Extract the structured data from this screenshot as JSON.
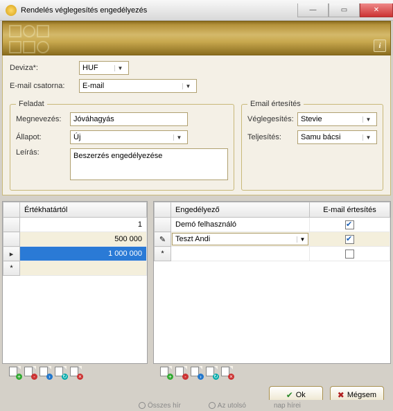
{
  "window": {
    "title": "Rendelés véglegesítés engedélyezés"
  },
  "form": {
    "currency_label": "Deviza*:",
    "currency_value": "HUF",
    "email_channel_label": "E-mail csatorna:",
    "email_channel_value": "E-mail"
  },
  "task_group": {
    "legend": "Feladat",
    "name_label": "Megnevezés:",
    "name_value": "Jóváhagyás",
    "status_label": "Állapot:",
    "status_value": "Új",
    "desc_label": "Leírás:",
    "desc_value": "Beszerzés engedélyezése"
  },
  "notify_group": {
    "legend": "Email értesítés",
    "finalize_label": "Véglegesítés:",
    "finalize_value": "Stevie",
    "fulfill_label": "Teljesítés:",
    "fulfill_value": "Samu bácsi"
  },
  "left_grid": {
    "col_value": "Értékhatártól",
    "rows": [
      {
        "v": "1"
      },
      {
        "v": "500 000"
      },
      {
        "v": "1 000 000"
      }
    ]
  },
  "right_grid": {
    "col_approver": "Engedélyező",
    "col_email": "E-mail értesítés",
    "rows": [
      {
        "approver": "Demó felhasználó",
        "email": true
      },
      {
        "approver": "Teszt Andi",
        "email": true,
        "editing": true
      }
    ]
  },
  "buttons": {
    "ok": "Ok",
    "cancel": "Mégsem"
  },
  "strip": {
    "a": "Összes hír",
    "b": "Az utolsó",
    "c": "nap hírei"
  }
}
